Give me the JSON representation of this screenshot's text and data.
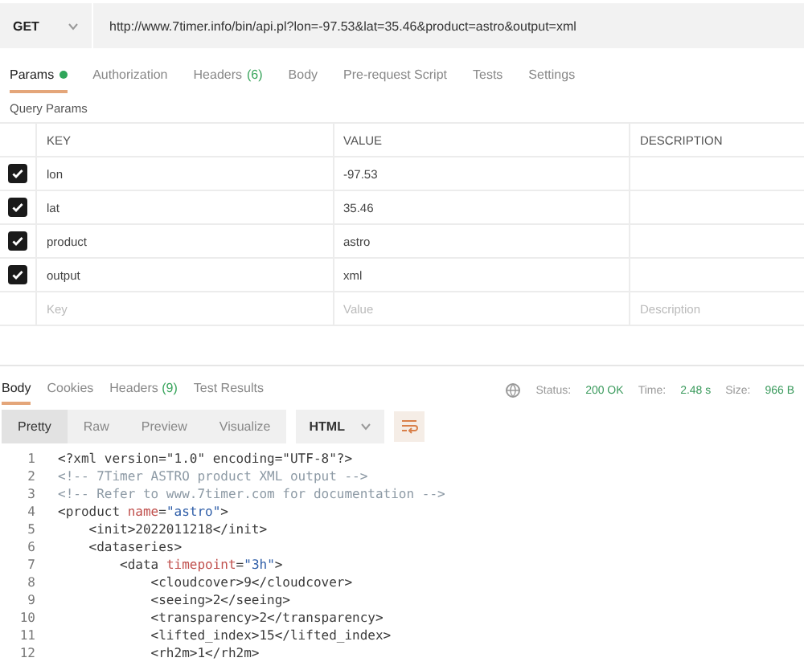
{
  "request": {
    "method": "GET",
    "url": "http://www.7timer.info/bin/api.pl?lon=-97.53&lat=35.46&product=astro&output=xml"
  },
  "request_tabs": [
    {
      "label": "Params",
      "dot": true,
      "selected": true
    },
    {
      "label": "Authorization",
      "dot": false,
      "selected": false
    },
    {
      "label": "Headers",
      "count": "(6)",
      "dot": false,
      "selected": false
    },
    {
      "label": "Body",
      "dot": false,
      "selected": false
    },
    {
      "label": "Pre-request Script",
      "dot": false,
      "selected": false
    },
    {
      "label": "Tests",
      "dot": false,
      "selected": false
    },
    {
      "label": "Settings",
      "dot": false,
      "selected": false
    }
  ],
  "query_params": {
    "title": "Query Params",
    "columns": [
      "KEY",
      "VALUE",
      "DESCRIPTION"
    ],
    "rows": [
      {
        "checked": true,
        "key": "lon",
        "value": "-97.53"
      },
      {
        "checked": true,
        "key": "lat",
        "value": "35.46"
      },
      {
        "checked": true,
        "key": "product",
        "value": "astro"
      },
      {
        "checked": true,
        "key": "output",
        "value": "xml"
      }
    ],
    "new_row": {
      "key_placeholder": "Key",
      "value_placeholder": "Value",
      "description_placeholder": "Description"
    }
  },
  "response_tabs": [
    {
      "label": "Body",
      "selected": true
    },
    {
      "label": "Cookies",
      "selected": false
    },
    {
      "label": "Headers",
      "count": "(9)",
      "selected": false
    },
    {
      "label": "Test Results",
      "selected": false
    }
  ],
  "status": [
    {
      "label": "Status:",
      "value": "200 OK"
    },
    {
      "label": "Time:",
      "value": "2.48 s"
    },
    {
      "label": "Size:",
      "value": "966 B"
    }
  ],
  "view_modes": [
    {
      "label": "Pretty",
      "selected": true
    },
    {
      "label": "Raw",
      "selected": false
    },
    {
      "label": "Preview",
      "selected": false
    },
    {
      "label": "Visualize",
      "selected": false
    }
  ],
  "format": "HTML",
  "code_lines": [
    {
      "number": "1",
      "segments": [
        {
          "kind": "tag",
          "text": "<?xml version=\"1.0\" encoding=\"UTF-8\"?>"
        }
      ]
    },
    {
      "number": "2",
      "segments": [
        {
          "kind": "comment",
          "text": "<!-- 7Timer ASTRO product XML output -->"
        }
      ]
    },
    {
      "number": "3",
      "segments": [
        {
          "kind": "comment",
          "text": "<!-- Refer to www.7timer.com for documentation -->"
        }
      ]
    },
    {
      "number": "4",
      "segments": [
        {
          "kind": "tag",
          "text": "<product "
        },
        {
          "kind": "attr",
          "text": "name"
        },
        {
          "kind": "tag",
          "text": "="
        },
        {
          "kind": "value",
          "text": "\"astro\""
        },
        {
          "kind": "tag",
          "text": ">"
        }
      ]
    },
    {
      "number": "5",
      "segments": [
        {
          "kind": "tag",
          "text": "    <init>2022011218</init>"
        }
      ]
    },
    {
      "number": "6",
      "segments": [
        {
          "kind": "tag",
          "text": "    <dataseries>"
        }
      ]
    },
    {
      "number": "7",
      "segments": [
        {
          "kind": "tag",
          "text": "        <data "
        },
        {
          "kind": "attr",
          "text": "timepoint"
        },
        {
          "kind": "tag",
          "text": "="
        },
        {
          "kind": "value",
          "text": "\"3h\""
        },
        {
          "kind": "tag",
          "text": ">"
        }
      ]
    },
    {
      "number": "8",
      "segments": [
        {
          "kind": "tag",
          "text": "            <cloudcover>9</cloudcover>"
        }
      ]
    },
    {
      "number": "9",
      "segments": [
        {
          "kind": "tag",
          "text": "            <seeing>2</seeing>"
        }
      ]
    },
    {
      "number": "10",
      "segments": [
        {
          "kind": "tag",
          "text": "            <transparency>2</transparency>"
        }
      ]
    },
    {
      "number": "11",
      "segments": [
        {
          "kind": "tag",
          "text": "            <lifted_index>15</lifted_index>"
        }
      ]
    },
    {
      "number": "12",
      "segments": [
        {
          "kind": "tag",
          "text": "            <rh2m>1</rh2m>"
        }
      ]
    }
  ]
}
